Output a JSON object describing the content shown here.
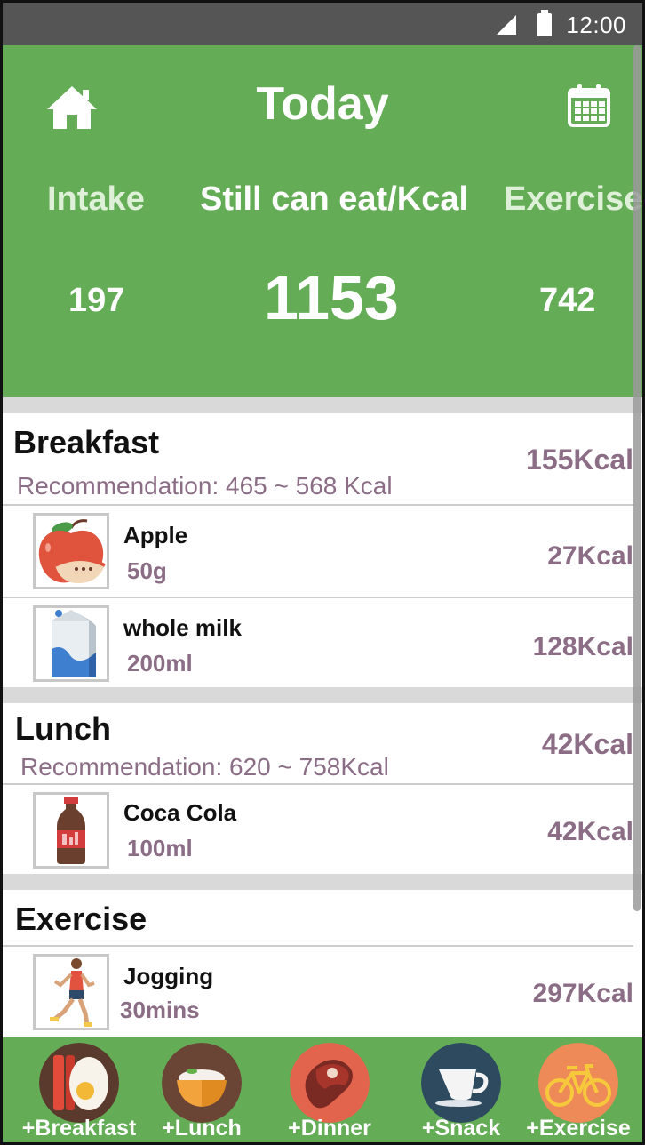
{
  "status_bar": {
    "time": "12:00"
  },
  "header": {
    "title": "Today",
    "intake_label": "Intake",
    "remaining_label": "Still can eat/Kcal",
    "exercise_label": "Exercise",
    "intake_value": "197",
    "remaining_value": "1153",
    "exercise_value": "742",
    "home_icon": "home-icon",
    "calendar_icon": "calendar-icon"
  },
  "breakfast": {
    "title": "Breakfast",
    "recommendation": "Recommendation: 465 ~ 568 Kcal",
    "total": "155Kcal",
    "items": [
      {
        "name": "Apple",
        "qty": "50g",
        "kcal": "27Kcal",
        "icon": "apple-icon"
      },
      {
        "name": "whole milk",
        "qty": "200ml",
        "kcal": "128Kcal",
        "icon": "milk-carton-icon"
      }
    ]
  },
  "lunch": {
    "title": "Lunch",
    "recommendation": "Recommendation: 620 ~ 758Kcal",
    "total": "42Kcal",
    "items": [
      {
        "name": "Coca Cola",
        "qty": "100ml",
        "kcal": "42Kcal",
        "icon": "cola-bottle-icon"
      }
    ]
  },
  "exercise": {
    "title": "Exercise",
    "items": [
      {
        "name": "Jogging",
        "qty": "30mins",
        "kcal": "297Kcal",
        "icon": "runner-icon"
      }
    ]
  },
  "bottom_bar": {
    "buttons": [
      {
        "label": "+Breakfast",
        "icon": "breakfast-icon",
        "color": "#5b3a2e"
      },
      {
        "label": "+Lunch",
        "icon": "rice-bowl-icon",
        "color": "#6a4535"
      },
      {
        "label": "+Dinner",
        "icon": "steak-icon",
        "color": "#e3644c"
      },
      {
        "label": "+Snack",
        "icon": "coffee-cup-icon",
        "color": "#2d4a5e"
      },
      {
        "label": "+Exercise",
        "icon": "bicycle-icon",
        "color": "#ee8a57"
      }
    ]
  },
  "colors": {
    "header_green": "#64ad56",
    "accent_purple": "#8b6d86",
    "status_gray": "#555555"
  }
}
